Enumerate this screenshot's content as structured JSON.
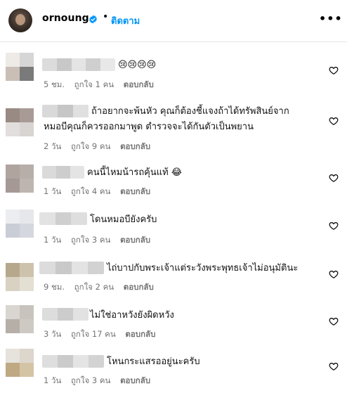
{
  "header": {
    "username": "ornoung",
    "separator": "•",
    "follow_label": "ติดตาม",
    "more_label": "•••",
    "verified_color": "#0095f6"
  },
  "comments": [
    {
      "text": "😢😢😢😢",
      "time": "5 ชม.",
      "likes": "ถูกใจ 1 คน",
      "reply": "ตอบกลับ"
    },
    {
      "text": "ถ้าอยากจะพ้นหัว คุณก็ต้องชี้แจงถ้าได้ทรัพสินย์จาก",
      "text2": "หมอบีคุณก็ควรออกมาพูด ตำรวจจะได้กันตัวเป็นพยาน",
      "time": "2 วัน",
      "likes": "ถูกใจ 9 คน",
      "reply": "ตอบกลับ"
    },
    {
      "text": "คนนี้ไหมน้ารถคุ้นแท้ 😂",
      "time": "1 วัน",
      "likes": "ถูกใจ 4 คน",
      "reply": "ตอบกลับ"
    },
    {
      "text": "โดนหมอบียังครับ",
      "time": "1 วัน",
      "likes": "ถูกใจ 3 คน",
      "reply": "ตอบกลับ"
    },
    {
      "text": "ไถ่บาปกับพระเจ้าแต่ระวังพระพุทธเจ้าไม่อนุมัตินะ",
      "time": "9 ชม.",
      "likes": "ถูกใจ 2 คน",
      "reply": "ตอบกลับ"
    },
    {
      "text": "ไม่ใช่อาหวังยังผิดหวัง",
      "time": "3 วัน",
      "likes": "ถูกใจ 17 คน",
      "reply": "ตอบกลับ"
    },
    {
      "text": "โหนกระแสรออยู่นะครับ",
      "time": "1 วัน",
      "likes": "ถูกใจ 3 คน",
      "reply": "ตอบกลับ"
    }
  ]
}
